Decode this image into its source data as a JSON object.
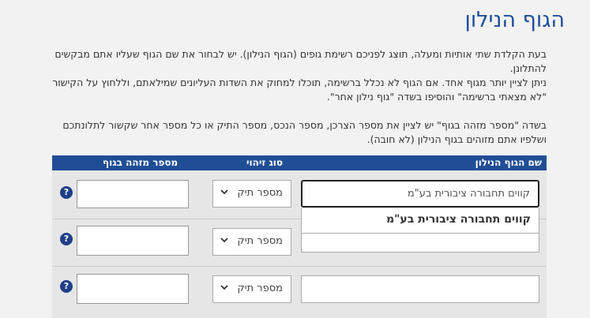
{
  "page": {
    "title": "הגוף הנילון",
    "para1": "בעת הקלדת שתי אותיות ומעלה, תוצג לפניכם רשימת גופים (הגוף הנילון). יש לבחור את שם הגוף שעליו אתם מבקשים להתלונן.",
    "para2": "ניתן לציין יותר מגוף אחד. אם הגוף לא נכלל ברשימה, תוכלו למחוק את השדות העליונים שמילאתם, וללחוץ על הקישור \"לא מצאתי ברשימה\" והוסיפו בשדה \"גוף נילון אחר\".",
    "para3": "בשדה \"מספר מזהה בגוף\" יש לציין את מספר הצרכן, מספר הנכס, מספר התיק או כל מספר אחר שקשור לתלונתכם ושלפיו אתם מזוהים בגוף הנילון (לא חובה)."
  },
  "table": {
    "headers": {
      "name": "שם הגוף הנילון",
      "type": "סוג זיהוי",
      "id": "מספר מזהה בגוף"
    },
    "rows": [
      {
        "name_value": "קווים תחבורה ציבורית בע\"מ",
        "type_value": "מספר תיק",
        "id_value": "",
        "help": "?"
      },
      {
        "name_value": "",
        "type_value": "מספר תיק",
        "id_value": "",
        "help": "?"
      },
      {
        "name_value": "",
        "type_value": "מספר תיק",
        "id_value": "",
        "help": "?"
      }
    ],
    "autocomplete": {
      "suggestion": "קווים תחבורה ציבורית בע\"מ"
    }
  },
  "colors": {
    "title": "#1f4f9a",
    "header_bg": "#1f4e94",
    "help_icon": "#1f3f88"
  }
}
